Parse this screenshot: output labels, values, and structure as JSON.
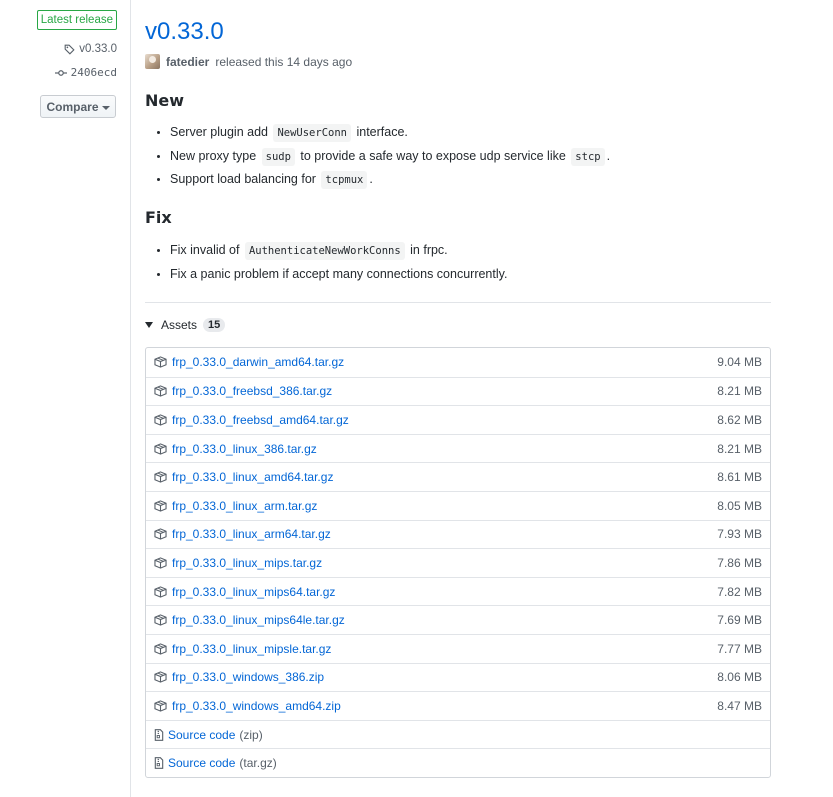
{
  "sidebar": {
    "latest_label": "Latest release",
    "tag": "v0.33.0",
    "commit": "2406ecd",
    "compare_label": "Compare"
  },
  "release": {
    "title": "v0.33.0",
    "author": "fatedier",
    "released_text": "released this 14 days ago"
  },
  "notes": {
    "new_heading": "New",
    "new_items": [
      {
        "pre": "Server plugin add ",
        "code": "NewUserConn",
        "post": " interface."
      },
      {
        "pre": "New proxy type ",
        "code": "sudp",
        "post": " to provide a safe way to expose udp service like ",
        "code2": "stcp",
        "post2": "."
      },
      {
        "pre": "Support load balancing for ",
        "code": "tcpmux",
        "post": "."
      }
    ],
    "fix_heading": "Fix",
    "fix_items": [
      {
        "pre": "Fix invalid of ",
        "code": "AuthenticateNewWorkConns",
        "post": " in frpc."
      },
      {
        "pre": "Fix a panic problem if accept many connections concurrently."
      }
    ]
  },
  "assets": {
    "label": "Assets",
    "count": "15",
    "files": [
      {
        "name": "frp_0.33.0_darwin_amd64.tar.gz",
        "size": "9.04 MB"
      },
      {
        "name": "frp_0.33.0_freebsd_386.tar.gz",
        "size": "8.21 MB"
      },
      {
        "name": "frp_0.33.0_freebsd_amd64.tar.gz",
        "size": "8.62 MB"
      },
      {
        "name": "frp_0.33.0_linux_386.tar.gz",
        "size": "8.21 MB"
      },
      {
        "name": "frp_0.33.0_linux_amd64.tar.gz",
        "size": "8.61 MB"
      },
      {
        "name": "frp_0.33.0_linux_arm.tar.gz",
        "size": "8.05 MB"
      },
      {
        "name": "frp_0.33.0_linux_arm64.tar.gz",
        "size": "7.93 MB"
      },
      {
        "name": "frp_0.33.0_linux_mips.tar.gz",
        "size": "7.86 MB"
      },
      {
        "name": "frp_0.33.0_linux_mips64.tar.gz",
        "size": "7.82 MB"
      },
      {
        "name": "frp_0.33.0_linux_mips64le.tar.gz",
        "size": "7.69 MB"
      },
      {
        "name": "frp_0.33.0_linux_mipsle.tar.gz",
        "size": "7.77 MB"
      },
      {
        "name": "frp_0.33.0_windows_386.zip",
        "size": "8.06 MB"
      },
      {
        "name": "frp_0.33.0_windows_amd64.zip",
        "size": "8.47 MB"
      }
    ],
    "source": [
      {
        "name": "Source code",
        "format": "(zip)"
      },
      {
        "name": "Source code",
        "format": "(tar.gz)"
      }
    ]
  },
  "icons": {
    "tag": "tag-icon",
    "commit": "git-commit-icon",
    "package": "package-icon",
    "file_zip": "file-zip-icon"
  },
  "colors": {
    "link": "#0366d6",
    "latest_green": "#28a745",
    "muted": "#586069"
  }
}
